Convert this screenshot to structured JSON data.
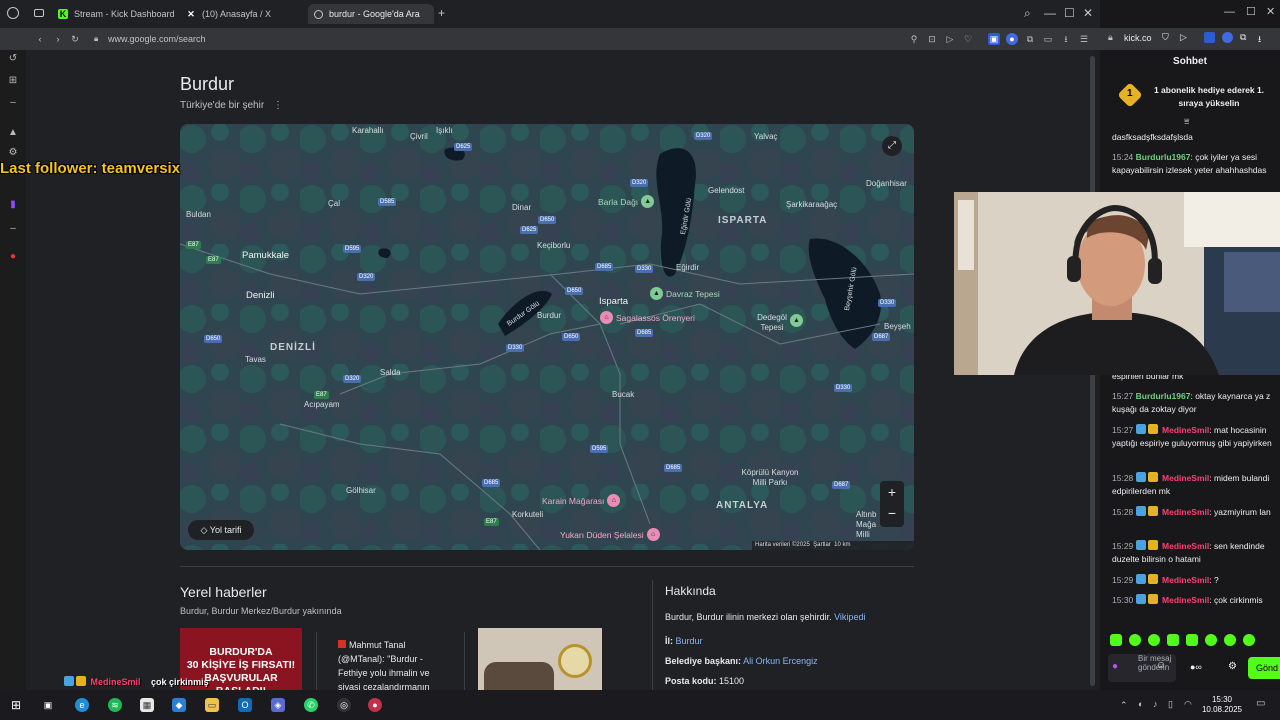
{
  "browser": {
    "tabs": [
      {
        "label": "Stream - Kick Dashboard",
        "active": false
      },
      {
        "label": "(10) Anasayfa / X",
        "active": false
      },
      {
        "label": "burdur - Google'da Ara",
        "active": true
      }
    ],
    "url": "www.google.com/search",
    "kick_url": "kick.co"
  },
  "google": {
    "title": "Burdur",
    "subtitle": "Türkiye'de bir şehir",
    "map": {
      "labels": {
        "karahalli": "Karahallı",
        "civril": "Çivril",
        "isikli": "Işıklı",
        "yalvac": "Yalvaç",
        "doganhisar": "Doğanhisar",
        "gelendost": "Gelendost",
        "sarkikaraagac": "Şarkikaraağaç",
        "cal": "Çal",
        "buldan": "Buldan",
        "dinar": "Dinar",
        "kecikorlu": "Keçiborlu",
        "egirdir_golu": "Eğirdir Gölü",
        "isparta_region": "ISPARTA",
        "pamukkale": "Pamukkale",
        "denizli": "Denizli",
        "egirdir": "Eğirdir",
        "beysehir_golu": "Beyşehir Gölü",
        "burdur_golu": "Burdur Gölü",
        "isparta": "Isparta",
        "burdur": "Burdur",
        "denizli_region": "DENİZLİ",
        "tavas": "Tavas",
        "salda": "Salda",
        "acipayam": "Acıpayam",
        "bucak": "Bucak",
        "beyshehir": "Beyşeh",
        "golhisar": "Gölhisar",
        "korkuteli": "Korkuteli",
        "antalya_region": "ANTALYA",
        "koprulu": "Köprülü Kanyon Milli Parkı",
        "altinbesik": "Altınb Mağa Milli",
        "dedegol": "Dedegöl Tepesi"
      },
      "pois": {
        "barla": "Barla Dağı",
        "davraz": "Davraz Tepesi",
        "sagalassos": "Sagalassos Örenyeri",
        "karain": "Karain Mağarası",
        "yukari_duden": "Yukarı Düden Şelalesi"
      },
      "roads": [
        "D320",
        "D625",
        "D585",
        "D650",
        "D625",
        "D320",
        "D595",
        "D320",
        "D685",
        "D330",
        "D650",
        "D685",
        "D650",
        "D330",
        "D650",
        "D320",
        "D330",
        "D687",
        "D330",
        "D687",
        "D595",
        "D685",
        "D685",
        "D650",
        "E87",
        "E87",
        "E87",
        "E87",
        "D320"
      ],
      "directions_label": "Yol tarifi",
      "attribution": "Harita verileri ©2025",
      "terms": "Şartlar",
      "scale": "10 km"
    },
    "news": {
      "title": "Yerel haberler",
      "subtitle": "Burdur, Burdur Merkez/Burdur yakınında",
      "card_image_text": "BURDUR'DA\n30 KİŞİYE İŞ FIRSATI!\nBAŞVURULAR BAŞLADI!",
      "article_author": "Mahmut Tanal",
      "article_handle": "(@MTanal): \"Burdur -",
      "article_line2": "Fethiye yolu ihmalin ve",
      "article_line3": "siyasi cezalandırmanın"
    },
    "about": {
      "title": "Hakkında",
      "desc": "Burdur, Burdur ilinin merkezi olan şehirdir.",
      "wiki": "Vikipedi",
      "il_label": "İl:",
      "il_value": "Burdur",
      "mayor_label": "Belediye başkanı:",
      "mayor_value": "Ali Orkun Ercengiz",
      "postal_label": "Posta kodu:",
      "postal_value": "15100"
    }
  },
  "overlay": {
    "last_follower": "Last follower: teamversix",
    "bottom_user": "MedineSmil",
    "bottom_msg": "çok çirkinmiş"
  },
  "chat": {
    "header": "Sohbet",
    "pinned": "1 abonelik hediye ederek 1. sıraya yükselin",
    "messages": [
      {
        "time": "",
        "user": "",
        "text": "dasfksadşfksdafşlsda"
      },
      {
        "time": "15:24",
        "user": "Burdurlu1967",
        "text": "çok iyiler ya sesi kapayabilirsin izlesek yeter ahahhashdas"
      },
      {
        "time": "",
        "user": "",
        "text": "espirileri bunlar mk"
      },
      {
        "time": "15:27",
        "user": "Burdurlu1967",
        "text": "oktay kaynarca ya z kuşağı da zoktay diyor"
      },
      {
        "time": "15:27",
        "user": "MedineSmil",
        "text": "mat hocasinin yaptığı espiriye guluyormuş gibi yapiyirken"
      },
      {
        "time": "15:28",
        "user": "MedineSmil",
        "text": "midem bulandi edpirilerden mk"
      },
      {
        "time": "15:28",
        "user": "MedineSmil",
        "text": "yazmiyirum lan"
      },
      {
        "time": "15:29",
        "user": "MedineSmil",
        "text": "sen kendinde duzelte bilirsin o hatami"
      },
      {
        "time": "15:29",
        "user": "MedineSmil",
        "text": "?"
      },
      {
        "time": "15:30",
        "user": "MedineSmil",
        "text": "çok cirkinmis"
      }
    ],
    "input_placeholder": "Bir mesaj gönderin",
    "send_label": "Gönd"
  },
  "taskbar": {
    "time": "15:30",
    "date": "10.08.2025"
  },
  "colors": {
    "accent_blue": "#8ab4f8",
    "kick_green": "#53fc18",
    "follower_yellow": "#f5c518",
    "user_green": "#6dd27e",
    "user_pink": "#ff3f73"
  }
}
